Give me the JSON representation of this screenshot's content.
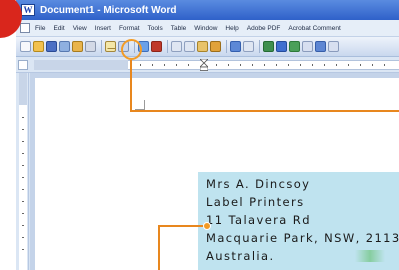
{
  "window": {
    "title": "Document1 - Microsoft Word",
    "app_icon": "word-icon"
  },
  "menubar": {
    "items": [
      "File",
      "Edit",
      "View",
      "Insert",
      "Format",
      "Tools",
      "Table",
      "Window",
      "Help",
      "Adobe PDF",
      "Acrobat Comment"
    ]
  },
  "toolbar": {
    "highlighted_button": "envelopes-and-labels-icon"
  },
  "address_label": {
    "lines": [
      "Mrs A. Dincsoy",
      "Label Printers",
      "11 Talavera Rd",
      "Macquarie Park, NSW, 2113",
      "Australia."
    ]
  },
  "colors": {
    "badge": "#d9261c",
    "callout": "#e8871e",
    "label_background": "#bfe3ef"
  }
}
